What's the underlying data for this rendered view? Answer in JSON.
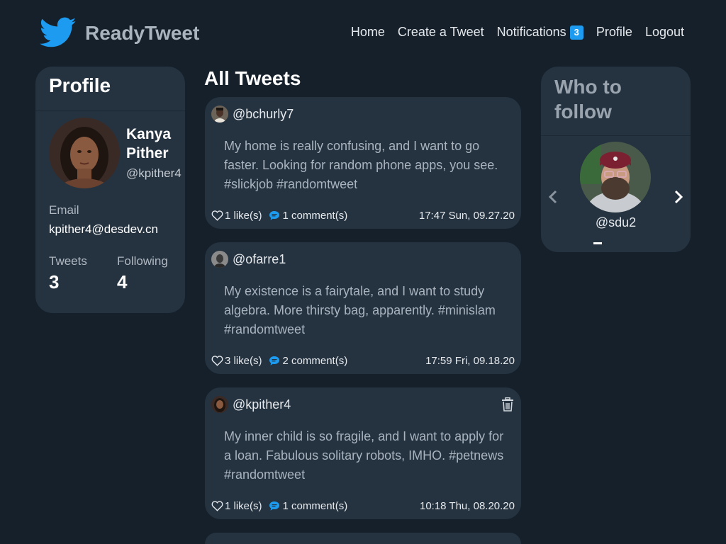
{
  "app": {
    "brand_name": "ReadyTweet",
    "accent_color": "#1d9bf0",
    "logo_icon": "twitter-bird-icon"
  },
  "nav": {
    "home": "Home",
    "create": "Create a Tweet",
    "notifications": "Notifications",
    "notifications_count": "3",
    "profile": "Profile",
    "logout": "Logout"
  },
  "profile": {
    "title": "Profile",
    "name": "Kanya Pither",
    "handle": "@kpither4",
    "email_label": "Email",
    "email": "kpither4@desdev.cn",
    "tweets_label": "Tweets",
    "tweets_count": "3",
    "following_label": "Following",
    "following_count": "4"
  },
  "feed": {
    "title": "All Tweets",
    "tweets": [
      {
        "handle": "@bchurly7",
        "text": "My home is really confusing, and I want to go faster. Looking for random phone apps, you see. #slickjob #randomtweet",
        "likes": "1 like(s)",
        "comments": "1 comment(s)",
        "time": "17:47 Sun, 09.27.20"
      },
      {
        "handle": "@ofarre1",
        "text": "My existence is a fairytale, and I want to study algebra. More thirsty bag, apparently. #minislam #randomtweet",
        "likes": "3 like(s)",
        "comments": "2 comment(s)",
        "time": "17:59 Fri, 09.18.20"
      },
      {
        "handle": "@kpither4",
        "text": "My inner child is so fragile, and I want to apply for a loan. Fabulous solitary robots, IMHO. #petnews #randomtweet",
        "likes": "1 like(s)",
        "comments": "1 comment(s)",
        "time": "10:18 Thu, 08.20.20"
      }
    ]
  },
  "who_to_follow": {
    "title": "Who to follow",
    "handle": "@sdu2"
  }
}
